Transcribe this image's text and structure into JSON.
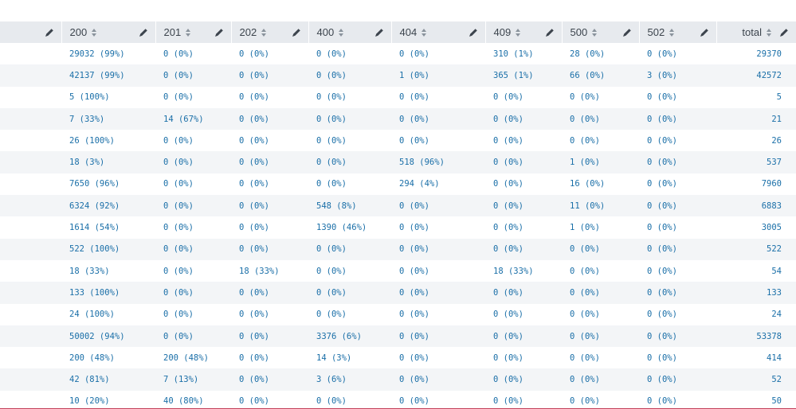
{
  "table": {
    "columns": [
      "",
      "200",
      "201",
      "202",
      "400",
      "404",
      "409",
      "500",
      "502",
      "total"
    ],
    "rows": [
      [
        "",
        "29032 (99%)",
        "0 (0%)",
        "0 (0%)",
        "0 (0%)",
        "0 (0%)",
        "310 (1%)",
        "28 (0%)",
        "0 (0%)",
        "29370"
      ],
      [
        "",
        "42137 (99%)",
        "0 (0%)",
        "0 (0%)",
        "0 (0%)",
        "1 (0%)",
        "365 (1%)",
        "66 (0%)",
        "3 (0%)",
        "42572"
      ],
      [
        "",
        "5 (100%)",
        "0 (0%)",
        "0 (0%)",
        "0 (0%)",
        "0 (0%)",
        "0 (0%)",
        "0 (0%)",
        "0 (0%)",
        "5"
      ],
      [
        "",
        "7 (33%)",
        "14 (67%)",
        "0 (0%)",
        "0 (0%)",
        "0 (0%)",
        "0 (0%)",
        "0 (0%)",
        "0 (0%)",
        "21"
      ],
      [
        "",
        "26 (100%)",
        "0 (0%)",
        "0 (0%)",
        "0 (0%)",
        "0 (0%)",
        "0 (0%)",
        "0 (0%)",
        "0 (0%)",
        "26"
      ],
      [
        "",
        "18 (3%)",
        "0 (0%)",
        "0 (0%)",
        "0 (0%)",
        "518 (96%)",
        "0 (0%)",
        "1 (0%)",
        "0 (0%)",
        "537"
      ],
      [
        "",
        "7650 (96%)",
        "0 (0%)",
        "0 (0%)",
        "0 (0%)",
        "294 (4%)",
        "0 (0%)",
        "16 (0%)",
        "0 (0%)",
        "7960"
      ],
      [
        "",
        "6324 (92%)",
        "0 (0%)",
        "0 (0%)",
        "548 (8%)",
        "0 (0%)",
        "0 (0%)",
        "11 (0%)",
        "0 (0%)",
        "6883"
      ],
      [
        "",
        "1614 (54%)",
        "0 (0%)",
        "0 (0%)",
        "1390 (46%)",
        "0 (0%)",
        "0 (0%)",
        "1 (0%)",
        "0 (0%)",
        "3005"
      ],
      [
        "",
        "522 (100%)",
        "0 (0%)",
        "0 (0%)",
        "0 (0%)",
        "0 (0%)",
        "0 (0%)",
        "0 (0%)",
        "0 (0%)",
        "522"
      ],
      [
        "",
        "18 (33%)",
        "0 (0%)",
        "18 (33%)",
        "0 (0%)",
        "0 (0%)",
        "18 (33%)",
        "0 (0%)",
        "0 (0%)",
        "54"
      ],
      [
        "",
        "133 (100%)",
        "0 (0%)",
        "0 (0%)",
        "0 (0%)",
        "0 (0%)",
        "0 (0%)",
        "0 (0%)",
        "0 (0%)",
        "133"
      ],
      [
        "",
        "24 (100%)",
        "0 (0%)",
        "0 (0%)",
        "0 (0%)",
        "0 (0%)",
        "0 (0%)",
        "0 (0%)",
        "0 (0%)",
        "24"
      ],
      [
        "",
        "50002 (94%)",
        "0 (0%)",
        "0 (0%)",
        "3376 (6%)",
        "0 (0%)",
        "0 (0%)",
        "0 (0%)",
        "0 (0%)",
        "53378"
      ],
      [
        "",
        "200 (48%)",
        "200 (48%)",
        "0 (0%)",
        "14 (3%)",
        "0 (0%)",
        "0 (0%)",
        "0 (0%)",
        "0 (0%)",
        "414"
      ],
      [
        "",
        "42 (81%)",
        "7 (13%)",
        "0 (0%)",
        "3 (6%)",
        "0 (0%)",
        "0 (0%)",
        "0 (0%)",
        "0 (0%)",
        "52"
      ],
      [
        "",
        "10 (20%)",
        "40 (80%)",
        "0 (0%)",
        "0 (0%)",
        "0 (0%)",
        "0 (0%)",
        "0 (0%)",
        "0 (0%)",
        "50"
      ]
    ]
  },
  "icons": {
    "sort": "sort-icon",
    "edit": "pencil-icon"
  },
  "colors": {
    "header_bg": "#e7eaee",
    "link_text": "#1a6fa8",
    "stripe": "#f3f5f7"
  }
}
